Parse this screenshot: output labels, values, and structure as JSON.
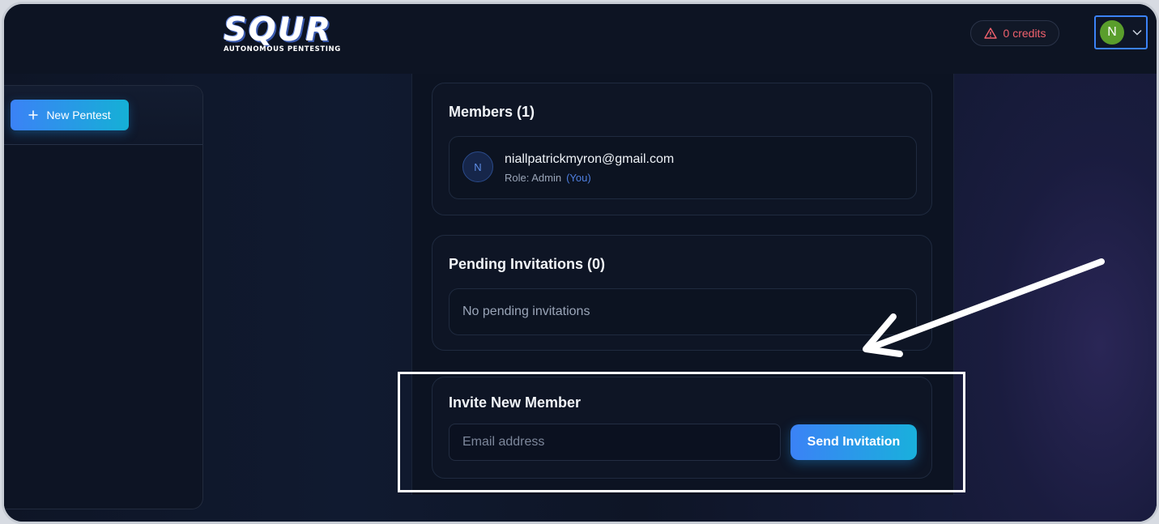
{
  "header": {
    "logo_word": "SQUR",
    "logo_tagline": "AUTONOMOUS PENTESTING",
    "credits_label": "0 credits",
    "user_initial": "N",
    "icons": [
      "warning-icon",
      "chevron-down-icon"
    ]
  },
  "sidebar": {
    "new_pentest_label": "New Pentest",
    "icons": [
      "plus-icon"
    ]
  },
  "members": {
    "title": "Members (1)",
    "items": [
      {
        "initial": "N",
        "email": "niallpatrickmyron@gmail.com",
        "role": "Role: Admin",
        "you_tag": "(You)"
      }
    ]
  },
  "pending": {
    "title": "Pending Invitations (0)",
    "empty_text": "No pending invitations"
  },
  "invite": {
    "title": "Invite New Member",
    "email_placeholder": "Email address",
    "email_value": "",
    "send_label": "Send Invitation"
  },
  "colors": {
    "accent": "#3b82f6",
    "accent_end": "#15b0d6",
    "credits": "#f0616d",
    "avatar_green": "#5a9e2c",
    "you_link": "#4f7fe0"
  }
}
